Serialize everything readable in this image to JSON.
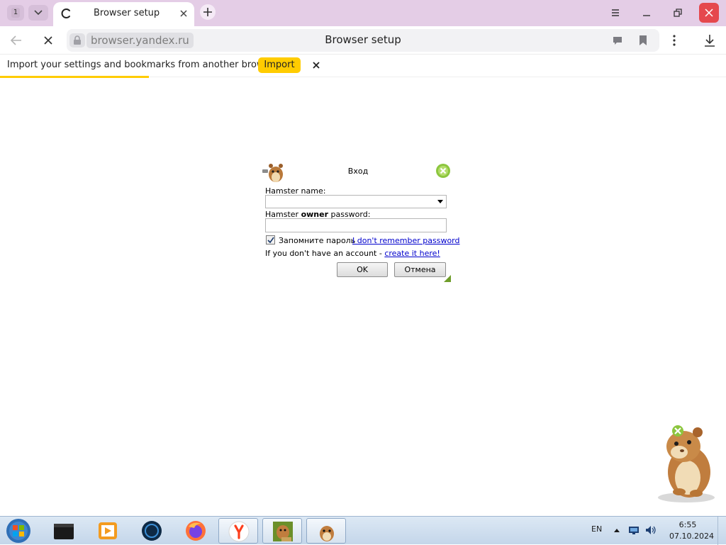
{
  "browser": {
    "tab_counter": "1",
    "tab_title": "Browser setup",
    "url": "browser.yandex.ru",
    "page_title": "Browser setup",
    "accent_color": "#ffcc00",
    "tabstrip_color": "#e4cde6"
  },
  "infobar": {
    "message": "Import your settings and bookmarks from another browser.",
    "import_label": "Import"
  },
  "dialog": {
    "title": "Вход",
    "name_label": "Hamster name:",
    "name_value": "",
    "owner_label_prefix": "Hamster ",
    "owner_label_bold": "owner",
    "owner_label_suffix": " password:",
    "password_value": "",
    "remember_label": "Запомните пароль",
    "remember_checked": true,
    "forgot_link": "I don't remember password",
    "no_account_text": "If you don't have an account - ",
    "create_link": "create it here!",
    "ok_label": "OK",
    "cancel_label": "Отмена"
  },
  "taskbar": {
    "items": [
      "terminal-icon",
      "media-player-icon",
      "browser-dark-icon",
      "firefox-icon",
      "yandex-browser-icon",
      "hamster-box-icon",
      "hamster-icon"
    ],
    "language": "EN",
    "time": "6:55",
    "date": "07.10.2024"
  }
}
